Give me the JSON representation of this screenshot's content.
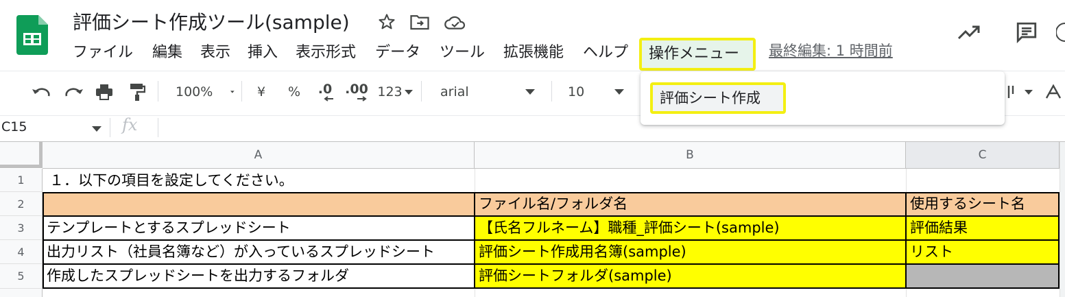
{
  "app": {
    "doc_title": "評価シート作成ツール(sample)",
    "last_edit": "最終編集: 1 時間前"
  },
  "menu": {
    "items": [
      "ファイル",
      "編集",
      "表示",
      "挿入",
      "表示形式",
      "データ",
      "ツール",
      "拡張機能",
      "ヘルプ"
    ],
    "custom_menu": "操作メニュー",
    "dropdown_item": "評価シート作成"
  },
  "toolbar": {
    "zoom": "100%",
    "currency": "¥",
    "percent": "%",
    "dec_decrease": ".0",
    "dec_increase": ".00",
    "more_formats": "123",
    "font": "arial",
    "font_size": "10"
  },
  "formula_bar": {
    "cell_ref": "C15",
    "fx": "fx",
    "value": ""
  },
  "sheet": {
    "columns": [
      "A",
      "B",
      "C"
    ],
    "rows": [
      "1",
      "2",
      "3",
      "4",
      "5"
    ],
    "cells": {
      "a1": "１．以下の項目を設定してください。",
      "a2": "",
      "b2": "ファイル名/フォルダ名",
      "c2": "使用するシート名",
      "a3": "テンプレートとするスプレッドシート",
      "b3": "【氏名フルネーム】職種_評価シート(sample)",
      "c3": "評価結果",
      "a4": "出力リスト（社員名簿など）が入っているスプレッドシート",
      "b4": "評価シート作成用名簿(sample)",
      "c4": "リスト",
      "a5": "作成したスプレッドシートを出力するフォルダ",
      "b5": "評価シートフォルダ(sample)",
      "c5": ""
    }
  },
  "colors": {
    "header_fill": "#f9cb9c",
    "input_fill": "#ffff00",
    "disabled_fill": "#b7b7b7",
    "highlight": "#f3ef12",
    "sheets_green": "#0f9d58"
  }
}
